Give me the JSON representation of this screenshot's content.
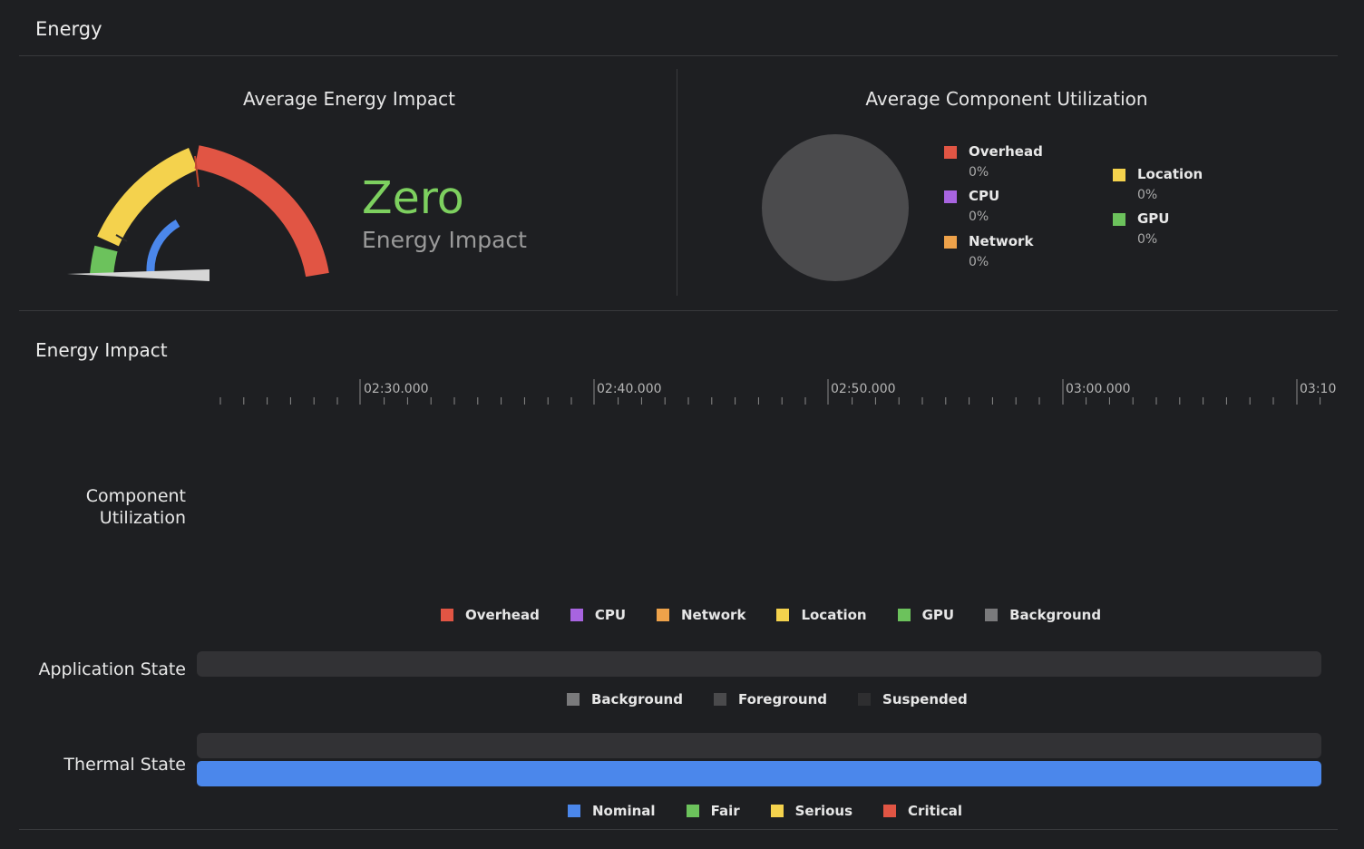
{
  "header": {
    "title": "Energy"
  },
  "energy_panel": {
    "title": "Average Energy Impact",
    "rating": "Zero",
    "rating_label": "Energy Impact",
    "rating_color": "#7dd05f"
  },
  "component_panel": {
    "title": "Average Component Utilization",
    "legend": [
      {
        "name": "Overhead",
        "pct": "0%",
        "color": "#e15544"
      },
      {
        "name": "CPU",
        "pct": "0%",
        "color": "#a864e0"
      },
      {
        "name": "Network",
        "pct": "0%",
        "color": "#eea24a"
      },
      {
        "name": "Location",
        "pct": "0%",
        "color": "#f4d24d"
      },
      {
        "name": "GPU",
        "pct": "0%",
        "color": "#6cc25c"
      }
    ]
  },
  "timeline": {
    "title": "Energy Impact",
    "ticks": [
      "02:30.000",
      "02:40.000",
      "02:50.000",
      "03:00.000",
      "03:10"
    ]
  },
  "component_row": {
    "label_line1": "Component",
    "label_line2": "Utilization",
    "legend": [
      {
        "name": "Overhead",
        "color": "#e15544"
      },
      {
        "name": "CPU",
        "color": "#a864e0"
      },
      {
        "name": "Network",
        "color": "#eea24a"
      },
      {
        "name": "Location",
        "color": "#f4d24d"
      },
      {
        "name": "GPU",
        "color": "#6cc25c"
      },
      {
        "name": "Background",
        "color": "#7a7a7c"
      }
    ]
  },
  "app_state_row": {
    "label": "Application State",
    "legend": [
      {
        "name": "Background",
        "color": "#7a7a7c"
      },
      {
        "name": "Foreground",
        "color": "#4a4a4c"
      },
      {
        "name": "Suspended",
        "color": "#2e2e30"
      }
    ]
  },
  "thermal_row": {
    "label": "Thermal State",
    "legend": [
      {
        "name": "Nominal",
        "color": "#4b87eb"
      },
      {
        "name": "Fair",
        "color": "#6cc25c"
      },
      {
        "name": "Serious",
        "color": "#f4d24d"
      },
      {
        "name": "Critical",
        "color": "#e15544"
      }
    ]
  }
}
